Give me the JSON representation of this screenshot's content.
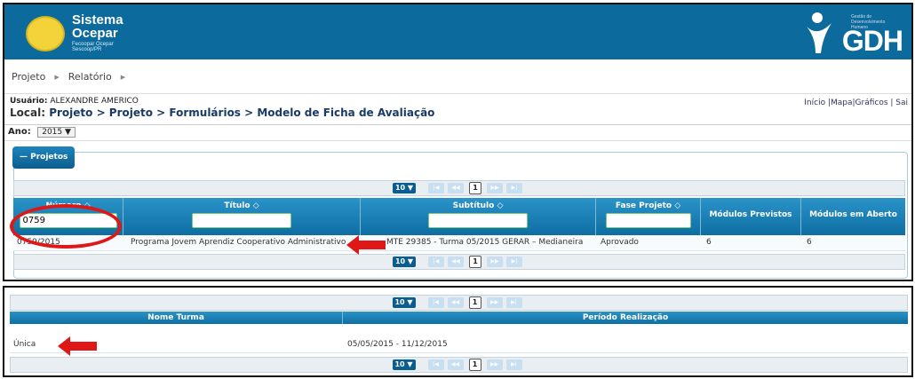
{
  "header": {
    "logo_line1": "Sistema",
    "logo_line2": "Ocepar",
    "logo_sub": "Fecoopar  Ocepar  Sescoop/PR",
    "gdh_text": "GDH",
    "gdh_small": "Gestão de Desenvolvimento Humano"
  },
  "menu": {
    "items": [
      "Projeto",
      "Relatório"
    ]
  },
  "user": {
    "label": "Usuário:",
    "name": "ALEXANDRE AMERICO",
    "local_label": "Local:",
    "local_path": "Projeto > Projeto > Formulários > Modelo de Ficha de Avaliação",
    "toplinks": "Início |Mapa|Gráficos | Sai"
  },
  "ano": {
    "label": "Ano:",
    "value": "2015 ▼"
  },
  "projetos": {
    "legend": "— Projetos",
    "pager": {
      "size": "10 ▼",
      "first": "|◀",
      "prev": "◀◀",
      "page": "1",
      "next": "▶▶",
      "last": "▶|"
    },
    "columns": {
      "numero": "Número ◇",
      "titulo": "Título ◇",
      "subtitulo": "Subtítulo ◇",
      "fase": "Fase Projeto ◇",
      "previstos": "Módulos Previstos",
      "aberto": "Módulos em Aberto"
    },
    "filters": {
      "numero": "0759",
      "titulo": "",
      "subtitulo": "",
      "fase": ""
    },
    "row": {
      "numero": "0759/2015",
      "titulo": "Programa Jovem Aprendiz Cooperativo Administrativo",
      "subtitulo": "MTE 29385 - Turma 05/2015 GERAR – Medianeira",
      "fase": "Aprovado",
      "previstos": "6",
      "aberto": "6"
    }
  },
  "turmas": {
    "pager": {
      "size": "10 ▼",
      "first": "|◀",
      "prev": "◀◀",
      "page": "1",
      "next": "▶▶",
      "last": "▶|"
    },
    "columns": {
      "nome": "Nome Turma",
      "periodo": "Período Realização"
    },
    "row": {
      "nome": "Única",
      "periodo": "05/05/2015 - 11/12/2015"
    }
  },
  "colors": {
    "accent": "#0c6b9c",
    "highlight": "#e01717"
  }
}
